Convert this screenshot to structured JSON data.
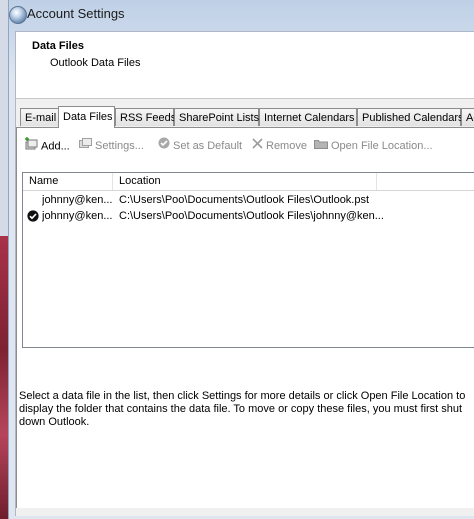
{
  "window": {
    "title": "Account Settings"
  },
  "header": {
    "title": "Data Files",
    "subtitle": "Outlook Data Files"
  },
  "tabs": [
    {
      "label": "E-mail"
    },
    {
      "label": "Data Files"
    },
    {
      "label": "RSS Feeds"
    },
    {
      "label": "SharePoint Lists"
    },
    {
      "label": "Internet Calendars"
    },
    {
      "label": "Published Calendars"
    },
    {
      "label": "Ac"
    }
  ],
  "toolbar": {
    "add": "Add...",
    "settings": "Settings...",
    "set_default": "Set as Default",
    "remove": "Remove",
    "open_location": "Open File Location..."
  },
  "list": {
    "columns": {
      "name": "Name",
      "location": "Location"
    },
    "rows": [
      {
        "name": "johnny@ken...",
        "location": "C:\\Users\\Poo\\Documents\\Outlook Files\\Outlook.pst",
        "is_default": false
      },
      {
        "name": "johnny@ken...",
        "location": "C:\\Users\\Poo\\Documents\\Outlook Files\\johnny@ken...",
        "is_default": true
      }
    ]
  },
  "description": "Select a data file in the list, then click Settings for more details or click Open File Location to display the folder that contains the data file. To move or copy these files, you must first shut down Outlook.",
  "colors": {
    "title_bar": "#c9d7ea",
    "desktop_strip": "#a8324a"
  }
}
